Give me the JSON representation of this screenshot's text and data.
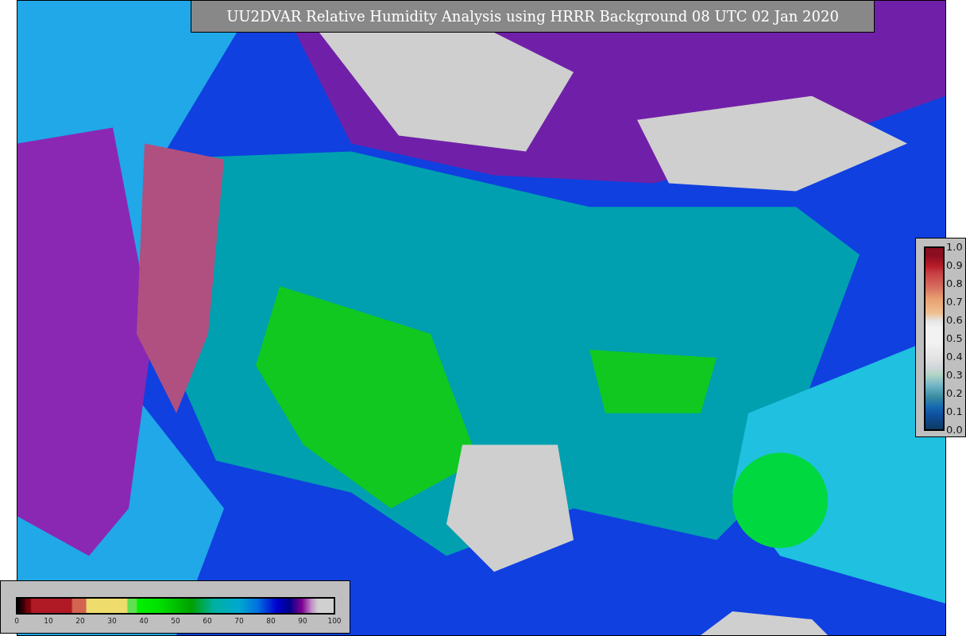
{
  "title": "UU2DVAR Relative Humidity Analysis using HRRR Background 08 UTC 02 Jan 2020",
  "colorbar_bottom": {
    "ticks": [
      "0",
      "10",
      "20",
      "30",
      "40",
      "50",
      "60",
      "70",
      "80",
      "90",
      "100"
    ]
  },
  "colorbar_right": {
    "ticks": [
      "1.0",
      "0.9",
      "0.8",
      "0.7",
      "0.6",
      "0.5",
      "0.4",
      "0.3",
      "0.2",
      "0.1",
      "0.0"
    ]
  }
}
